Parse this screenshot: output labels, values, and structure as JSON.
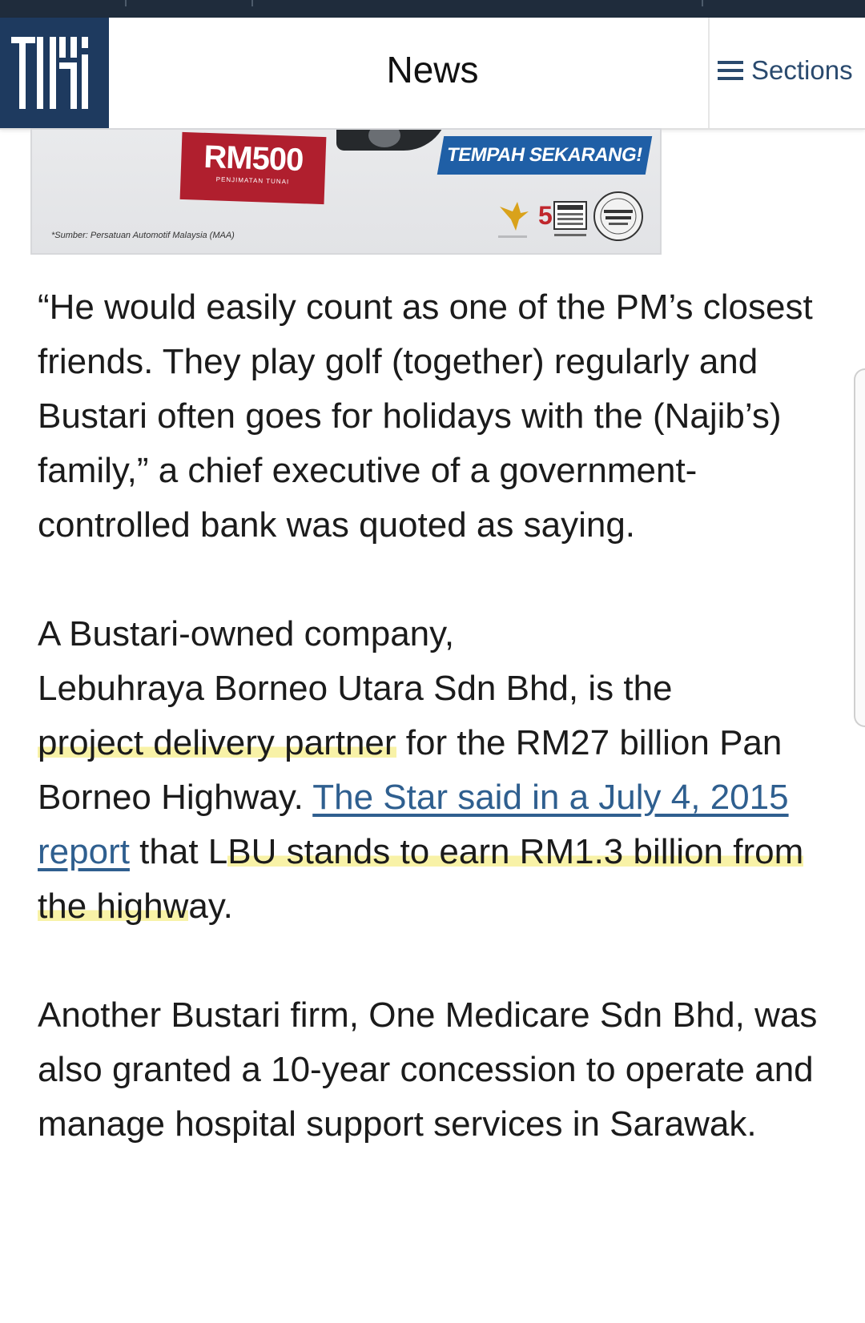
{
  "header": {
    "logo_text": "TMI",
    "title": "News",
    "sections_label": "Sections",
    "logo_color": "#1e3a5f",
    "accent_color": "#2a4a6e"
  },
  "ad": {
    "price": "RM500",
    "price_subtext": "PENJIMATAN TUNAI",
    "cta": "TEMPAH SEKARANG!",
    "source": "*Sumber: Persatuan Automotif Malaysia (MAA)",
    "rating_number": "5",
    "badge_text": "BINTANG",
    "seal_text": "NOMBOR PERKHIDMATAN"
  },
  "article": {
    "p1": "“He would easily count as one of the PM’s closest friends. They play golf (together) regularly and Bustari often goes for holidays with the (Najib’s) family,” a chief executive of a government-controlled bank was quoted as saying.",
    "p2_a": "A Bustari-owned company,",
    "p2_b": "Lebuhraya Borneo Utara Sdn Bhd, is the",
    "p2_hl1": "project delivery partner",
    "p2_c": " for the RM27 billion Pan Borneo Highway. ",
    "p2_link": "The Star said in a July 4, 2015 report",
    "p2_d": " that L",
    "p2_hl2": "BU stands to earn RM1.3 billion from the highw",
    "p2_e": "ay.",
    "p3": "Another Bustari firm, One Medicare Sdn Bhd, was also granted a 10-year concession to operate and manage hospital support services in Sarawak.",
    "link_color": "#2f5f8f",
    "highlight_color": "#f5eb78"
  }
}
